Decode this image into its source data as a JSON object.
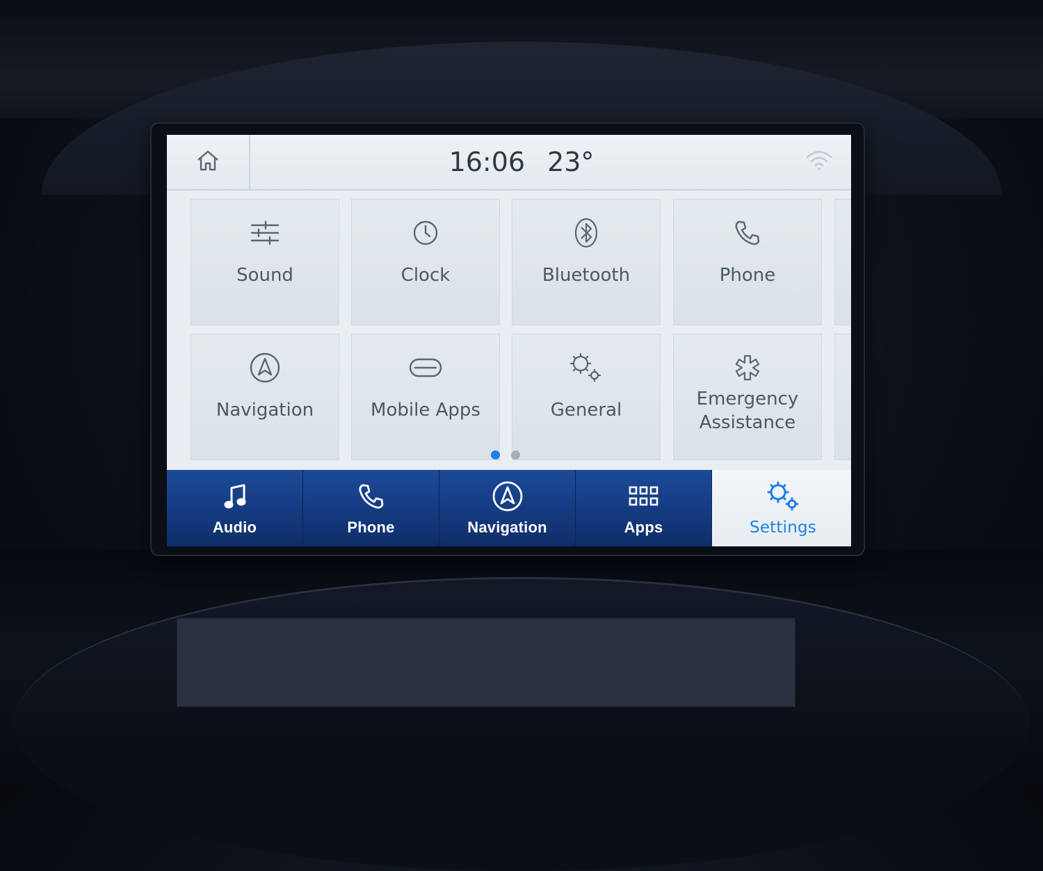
{
  "status_bar": {
    "time": "16:06",
    "temperature": "23°",
    "home_icon": "home-icon",
    "wifi_icon": "wifi-icon"
  },
  "settings_grid": [
    {
      "label": "Sound",
      "icon": "equalizer-icon"
    },
    {
      "label": "Clock",
      "icon": "clock-icon"
    },
    {
      "label": "Bluetooth",
      "icon": "bluetooth-icon"
    },
    {
      "label": "Phone",
      "icon": "phone-icon"
    },
    {
      "label": "Navigation",
      "icon": "navigation-icon"
    },
    {
      "label": "Mobile Apps",
      "icon": "mobile-apps-icon"
    },
    {
      "label": "General",
      "icon": "gears-icon"
    },
    {
      "label": "Emergency Assistance",
      "icon": "emergency-icon"
    }
  ],
  "pagination": {
    "current_page": 1,
    "total_pages": 2
  },
  "nav_bar": [
    {
      "label": "Audio",
      "icon": "music-note-icon",
      "active": false
    },
    {
      "label": "Phone",
      "icon": "phone-icon",
      "active": false
    },
    {
      "label": "Navigation",
      "icon": "navigation-icon",
      "active": false
    },
    {
      "label": "Apps",
      "icon": "apps-grid-icon",
      "active": false
    },
    {
      "label": "Settings",
      "icon": "settings-gear-icon",
      "active": true
    }
  ],
  "colors": {
    "accent_blue": "#1f7fe6",
    "nav_blue": "#143a80",
    "icon_gray": "#4c5860",
    "dot_inactive": "#9fb0bf"
  }
}
